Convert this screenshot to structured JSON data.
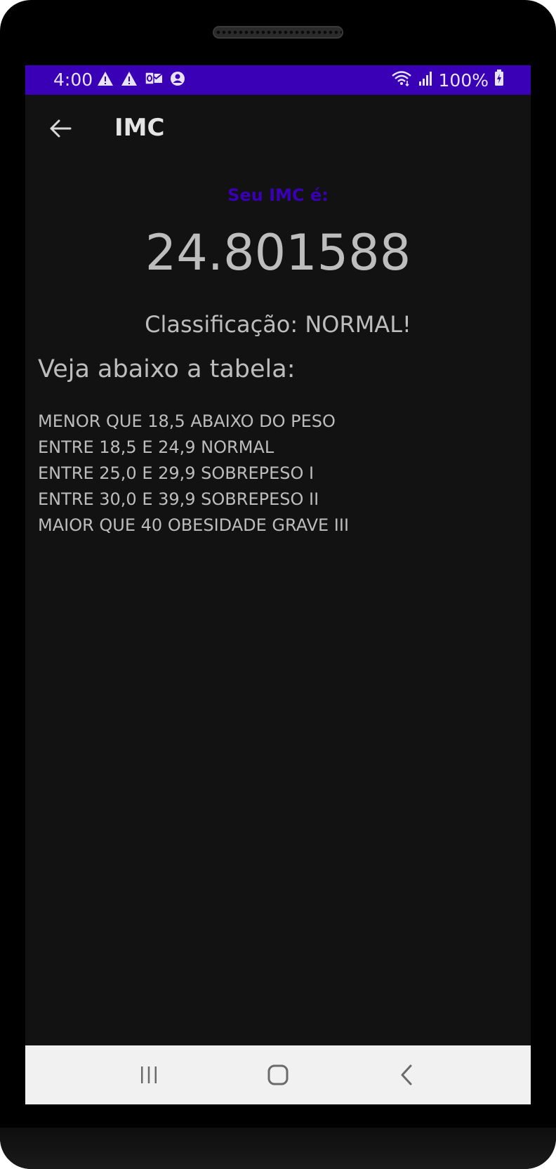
{
  "status_bar": {
    "time": "4:00",
    "battery": "100%",
    "background_color": "#3a00b6",
    "left_icons": [
      "warning-icon",
      "warning-icon",
      "outlook-icon",
      "account-icon"
    ],
    "right_icons": [
      "wifi-icon",
      "signal-icon",
      "battery-charging-icon"
    ]
  },
  "app_bar": {
    "title": "IMC",
    "back_icon": "arrow-back-icon"
  },
  "result": {
    "label": "Seu IMC é:",
    "value": "24.801588",
    "classification": "Classificação: NORMAL!"
  },
  "table": {
    "title": "Veja abaixo a tabela:",
    "rows": [
      "MENOR QUE 18,5 ABAIXO DO PESO",
      "ENTRE 18,5 E 24,9 NORMAL",
      "ENTRE 25,0 E 29,9 SOBREPESO I",
      "ENTRE 30,0 E 39,9 SOBREPESO II",
      "MAIOR QUE 40 OBESIDADE GRAVE III"
    ]
  },
  "nav_bar": {
    "buttons": [
      "recents-icon",
      "home-icon",
      "back-icon"
    ]
  },
  "colors": {
    "accent": "#3a00b6",
    "screen_background": "#121212",
    "text": "#bdbdbd",
    "nav_background": "#f1f1f1"
  }
}
